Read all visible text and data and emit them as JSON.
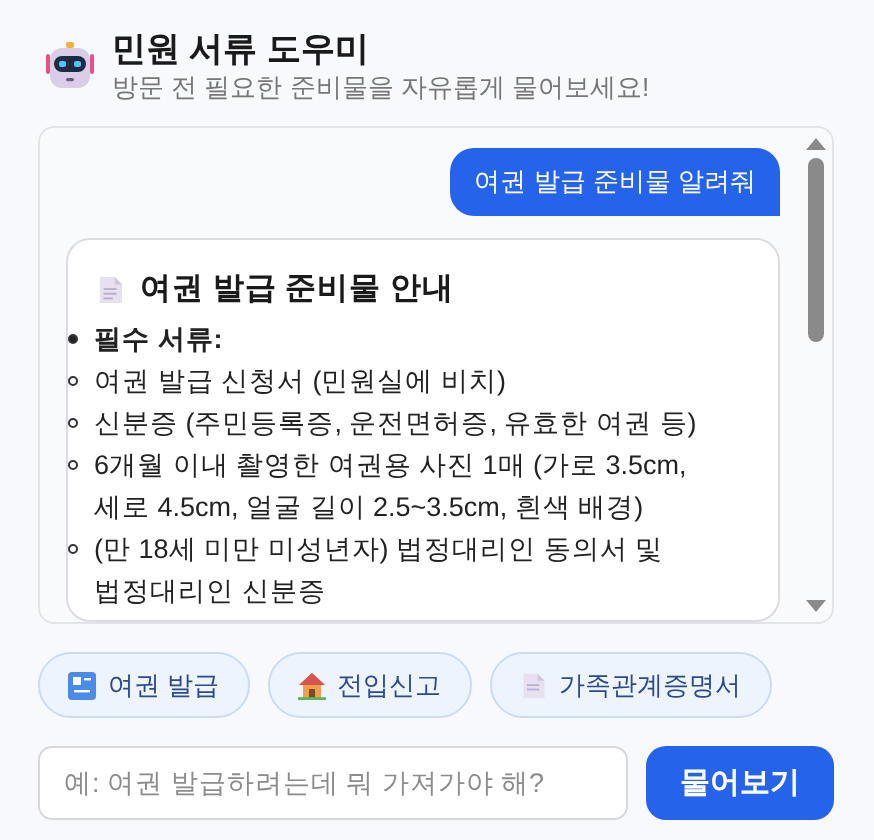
{
  "header": {
    "title": "민원 서류 도우미",
    "subtitle": "방문 전 필요한 준비물을 자유롭게 물어보세요!"
  },
  "messages": [
    {
      "kind": "user",
      "text": "여권 발급 준비물 알려줘"
    },
    {
      "kind": "bot",
      "title": "여권 발급 준비물 안내",
      "sections": [
        {
          "heading": "필수 서류:",
          "items": [
            "여권 발급 신청서 (민원실에 비치)",
            "신분증 (주민등록증, 운전면허증, 유효한 여권 등)",
            "6개월 이내 촬영한 여권용 사진 1매 (가로 3.5cm, 세로 4.5cm, 얼굴 길이 2.5~3.5cm, 흰색 배경)",
            "(만 18세 미만 미성년자) 법정대리인 동의서 및 법정대리인 신분증"
          ]
        }
      ]
    }
  ],
  "quick_replies": [
    {
      "label": "여권 발급",
      "kind": "passport"
    },
    {
      "label": "전입신고",
      "kind": "house"
    },
    {
      "label": "가족관계증명서",
      "kind": "document"
    }
  ],
  "input": {
    "placeholder": "예: 여권 발급하려는데 뭐 가져가야 해?"
  },
  "send_button": "물어보기"
}
